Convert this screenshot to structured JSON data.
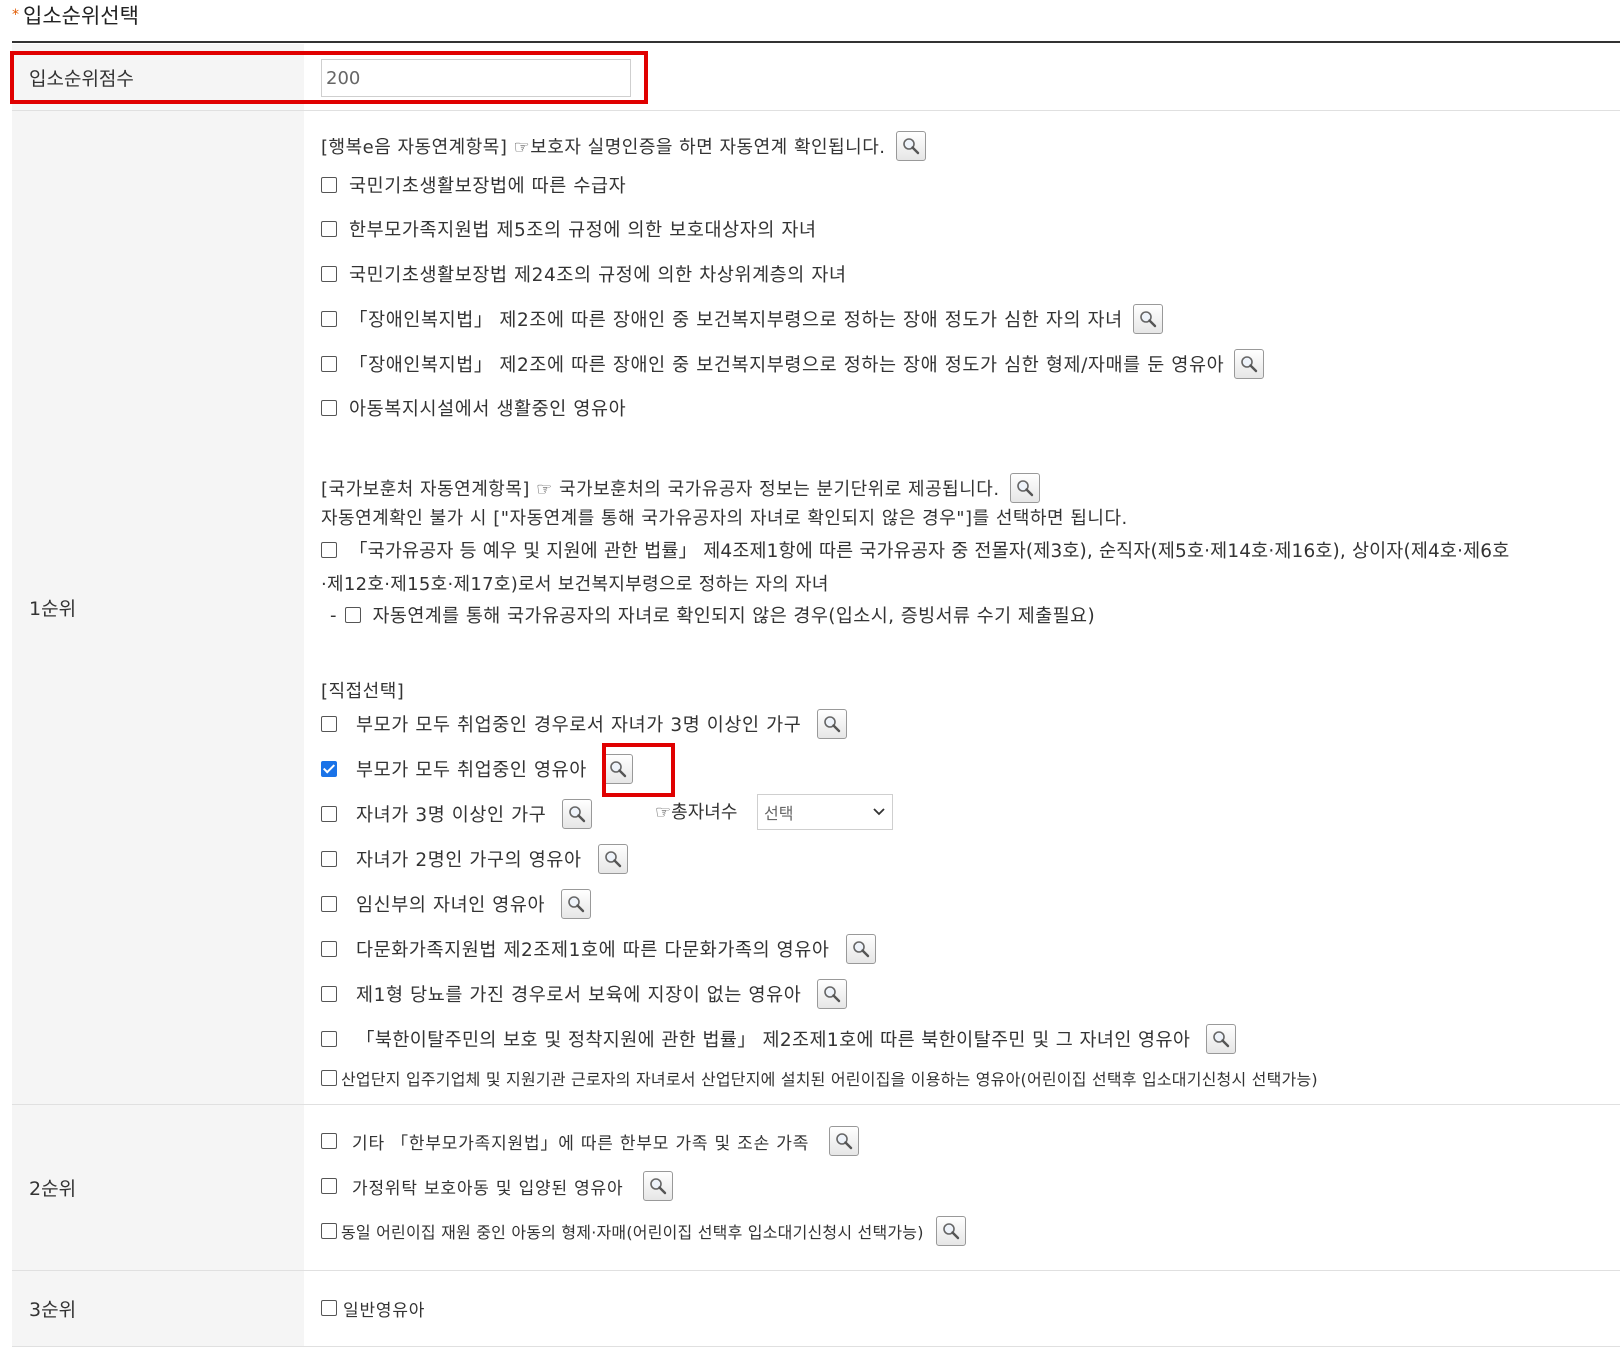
{
  "section": {
    "star": "*",
    "title": "입소순위선택"
  },
  "score": {
    "label": "입소순위점수",
    "value": "200"
  },
  "rank1": {
    "label": "1순위",
    "happy_note": "[행복e음 자동연계항목] ☞보호자 실명인증을 하면 자동연계 확인됩니다.",
    "happy_items": [
      "국민기초생활보장법에 따른 수급자",
      "한부모가족지원법 제5조의 규정에 의한 보호대상자의 자녀",
      "국민기초생활보장법 제24조의 규정에 의한 차상위계층의 자녀",
      "「장애인복지법」 제2조에 따른 장애인 중 보건복지부령으로 정하는 장애 정도가 심한 자의 자녀",
      "「장애인복지법」 제2조에 따른 장애인 중 보건복지부령으로 정하는 장애 정도가 심한 형제/자매를 둔 영유아",
      "아동복지시설에서 생활중인 영유아"
    ],
    "veteran_note1": "[국가보훈처 자동연계항목] ☞ 국가보훈처의 국가유공자 정보는 분기단위로 제공됩니다.",
    "veteran_note2": "자동연계확인 불가 시 [\"자동연계를 통해 국가유공자의 자녀로 확인되지 않은 경우\"]를 선택하면 됩니다.",
    "veteran_item_line1": "「국가유공자 등 예우 및 지원에 관한 법률」 제4조제1항에 따른 국가유공자 중 전몰자(제3호), 순직자(제5호·제14호·제16호), 상이자(제4호·제6호",
    "veteran_item_line2": "·제12호·제15호·제17호)로서 보건복지부령으로 정하는 자의 자녀",
    "veteran_sub_dash": "-",
    "veteran_sub_item": "자동연계를 통해 국가유공자의 자녀로 확인되지 않은 경우(입소시, 증빙서류 수기 제출필요)",
    "direct_note": "[직접선택]",
    "direct_items": [
      "부모가 모두 취업중인 경우로서 자녀가 3명 이상인 가구",
      "부모가 모두 취업중인 영유아",
      "자녀가 3명 이상인 가구",
      "자녀가 2명인 가구의 영유아",
      "임신부의 자녀인 영유아",
      "다문화가족지원법 제2조제1호에 따른 다문화가족의 영유아",
      "제1형 당뇨를 가진 경우로서 보육에 지장이 없는 영유아",
      "「북한이탈주민의 보호 및 정착지원에 관한 법률」 제2조제1호에 따른 북한이탈주민 및 그 자녀인 영유아"
    ],
    "children_count_label": "☞총자녀수",
    "children_count_select": "선택",
    "industrial_item": "산업단지 입주기업체 및 지원기관 근로자의 자녀로서 산업단지에 설치된 어린이집을 이용하는 영유아(어린이집 선택후 입소대기신청시 선택가능)"
  },
  "rank2": {
    "label": "2순위",
    "items": [
      "기타 「한부모가족지원법」에 따른 한부모 가족 및 조손 가족",
      "가정위탁 보호아동 및 입양된 영유아",
      "동일 어린이집 재원 중인 아동의 형제·자매(어린이집 선택후 입소대기신청시 선택가능)"
    ]
  },
  "rank3": {
    "label": "3순위",
    "items": [
      "일반영유아"
    ]
  },
  "colors": {
    "highlight": "#e00000",
    "checked": "#1a73e8",
    "header_bg": "#f5f5f5"
  }
}
